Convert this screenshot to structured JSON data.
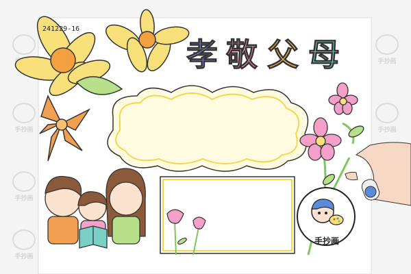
{
  "paper": {
    "code": "241229-16"
  },
  "title": {
    "chars": [
      "孝",
      "敬",
      "父",
      "母"
    ],
    "colors": [
      "#8a8ad8",
      "#e68aa0",
      "#f2b44a",
      "#7ad0c4"
    ]
  },
  "logo": {
    "text": "手抄画"
  },
  "watermark": {
    "text": "手抄画"
  },
  "colors": {
    "background": "#f4f4f4",
    "paper": "#ffffff",
    "sunflower": "#f8e07a",
    "orange_flower": "#f0a050",
    "leaf": "#b8e08a",
    "cloud_fill": "#fffbe0",
    "cloud_border": "#f2d84a",
    "pink_flower": "#f4a0c8",
    "stem": "#7cc85a"
  }
}
